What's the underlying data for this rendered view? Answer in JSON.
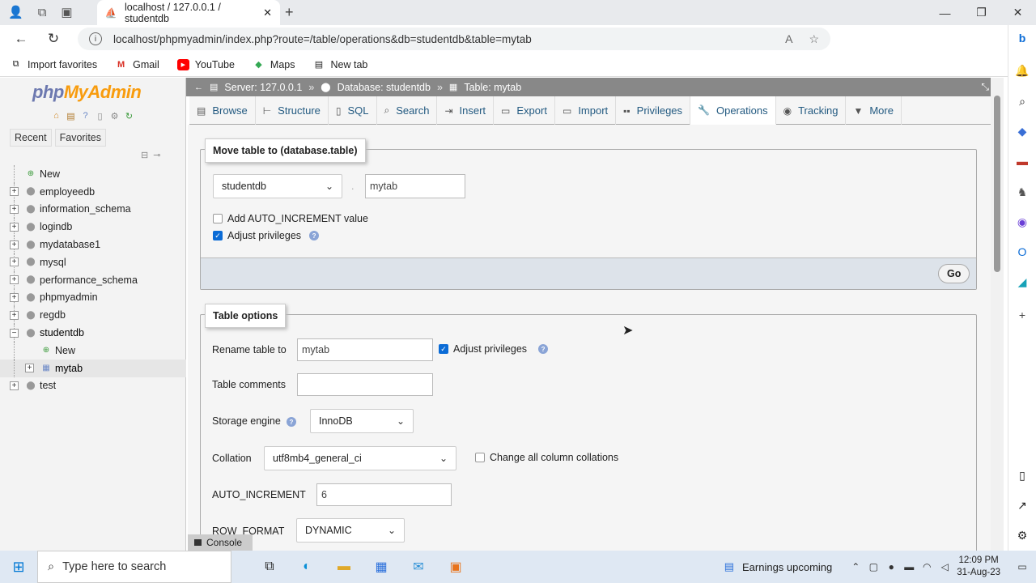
{
  "browser": {
    "tab_title": "localhost / 127.0.0.1 / studentdb",
    "url": "localhost/phpmyadmin/index.php?route=/table/operations&db=studentdb&table=mytab",
    "bookmarks": [
      "Import favorites",
      "Gmail",
      "YouTube",
      "Maps",
      "New tab"
    ]
  },
  "pma": {
    "logo_a": "php",
    "logo_b": "MyAdmin",
    "nav_tabs": [
      "Recent",
      "Favorites"
    ],
    "tree": {
      "new": "New",
      "dbs": [
        "employeedb",
        "information_schema",
        "logindb",
        "mydatabase1",
        "mysql",
        "performance_schema",
        "phpmyadmin",
        "regdb",
        "studentdb"
      ],
      "sub_new": "New",
      "sub_table": "mytab",
      "last": "test"
    },
    "breadcrumb": {
      "server": "Server: 127.0.0.1",
      "database": "Database: studentdb",
      "table": "Table: mytab"
    },
    "menu": [
      "Browse",
      "Structure",
      "SQL",
      "Search",
      "Insert",
      "Export",
      "Import",
      "Privileges",
      "Operations",
      "Tracking",
      "More"
    ],
    "move": {
      "legend": "Move table to (database.table)",
      "db_select": "studentdb",
      "dot": ".",
      "table_value": "mytab",
      "auto_inc": "Add AUTO_INCREMENT value",
      "adjust": "Adjust privileges",
      "go": "Go"
    },
    "options": {
      "legend": "Table options",
      "rename_label": "Rename table to",
      "rename_value": "mytab",
      "adjust": "Adjust privileges",
      "comments_label": "Table comments",
      "comments_value": "",
      "engine_label": "Storage engine",
      "engine_value": "InnoDB",
      "collation_label": "Collation",
      "collation_value": "utf8mb4_general_ci",
      "change_all": "Change all column collations",
      "autoinc_label": "AUTO_INCREMENT",
      "autoinc_value": "6",
      "rowformat_label": "ROW_FORMAT",
      "rowformat_value": "DYNAMIC"
    },
    "console": "Console"
  },
  "taskbar": {
    "search_placeholder": "Type here to search",
    "weather": "Earnings upcoming",
    "time": "12:09 PM",
    "date": "31-Aug-23"
  }
}
